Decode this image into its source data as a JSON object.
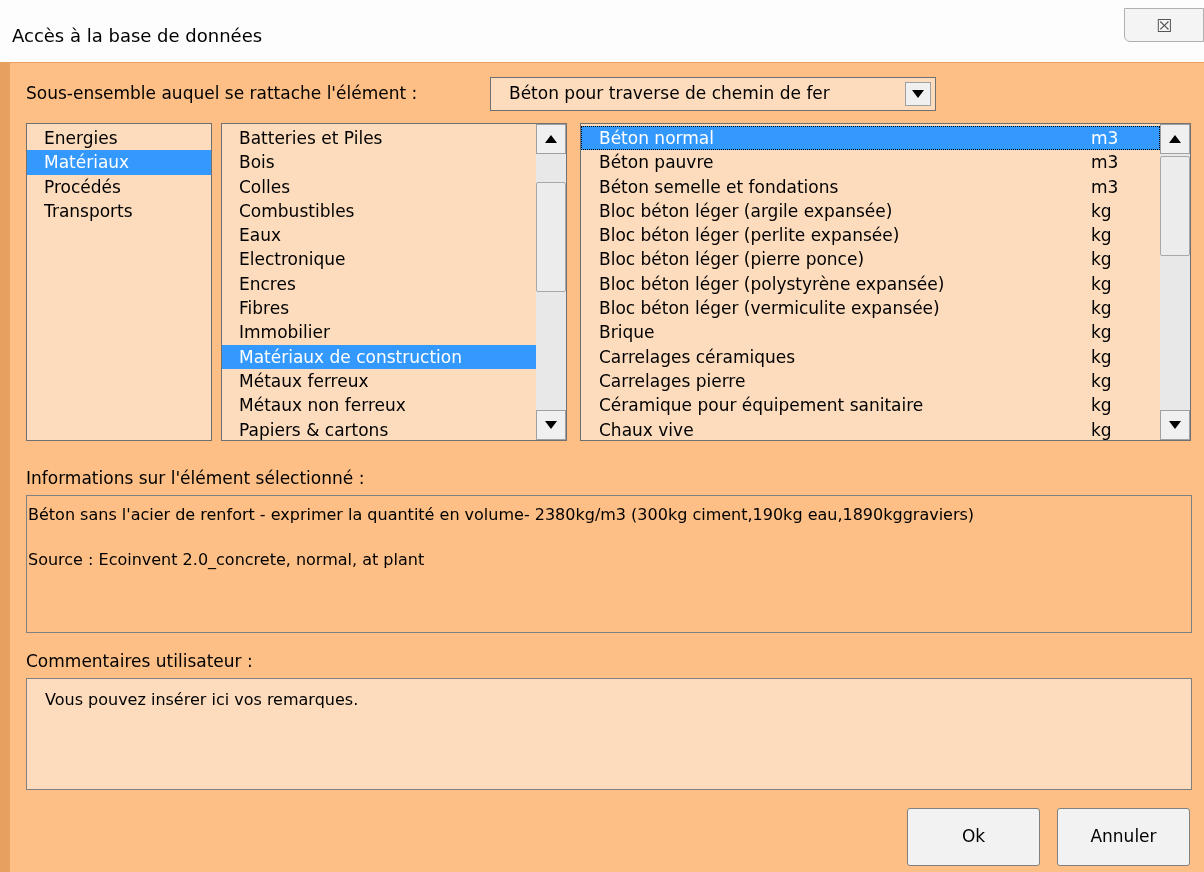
{
  "window": {
    "title": "Accès à la base de données",
    "close": "☒"
  },
  "subset": {
    "label": "Sous-ensemble auquel se rattache l'élément :",
    "value": "Béton pour traverse de chemin de fer"
  },
  "categories": [
    {
      "label": "Energies",
      "selected": false
    },
    {
      "label": "Matériaux",
      "selected": true
    },
    {
      "label": "Procédés",
      "selected": false
    },
    {
      "label": "Transports",
      "selected": false
    }
  ],
  "subcategories": [
    {
      "label": "Batteries et Piles",
      "selected": false
    },
    {
      "label": "Bois",
      "selected": false
    },
    {
      "label": "Colles",
      "selected": false
    },
    {
      "label": "Combustibles",
      "selected": false
    },
    {
      "label": "Eaux",
      "selected": false
    },
    {
      "label": "Electronique",
      "selected": false
    },
    {
      "label": "Encres",
      "selected": false
    },
    {
      "label": "Fibres",
      "selected": false
    },
    {
      "label": "Immobilier",
      "selected": false
    },
    {
      "label": "Matériaux de construction",
      "selected": true
    },
    {
      "label": "Métaux ferreux",
      "selected": false
    },
    {
      "label": "Métaux non ferreux",
      "selected": false
    },
    {
      "label": "Papiers & cartons",
      "selected": false
    }
  ],
  "elements": [
    {
      "name": "Béton normal",
      "unit": "m3",
      "selected": true
    },
    {
      "name": "Béton pauvre",
      "unit": "m3",
      "selected": false
    },
    {
      "name": "Béton semelle et fondations",
      "unit": "m3",
      "selected": false
    },
    {
      "name": "Bloc béton léger (argile expansée)",
      "unit": "kg",
      "selected": false
    },
    {
      "name": "Bloc béton léger (perlite expansée)",
      "unit": "kg",
      "selected": false
    },
    {
      "name": "Bloc béton léger (pierre ponce)",
      "unit": "kg",
      "selected": false
    },
    {
      "name": "Bloc béton léger (polystyrène expansée)",
      "unit": "kg",
      "selected": false
    },
    {
      "name": "Bloc béton léger (vermiculite expansée)",
      "unit": "kg",
      "selected": false
    },
    {
      "name": "Brique",
      "unit": "kg",
      "selected": false
    },
    {
      "name": "Carrelages céramiques",
      "unit": "kg",
      "selected": false
    },
    {
      "name": "Carrelages pierre",
      "unit": "kg",
      "selected": false
    },
    {
      "name": "Céramique pour équipement sanitaire",
      "unit": "kg",
      "selected": false
    },
    {
      "name": "Chaux vive",
      "unit": "kg",
      "selected": false
    }
  ],
  "info": {
    "label": "Informations sur l'élément sélectionné :",
    "lines": [
      "Béton sans l'acier de renfort - exprimer la quantité en volume- 2380kg/m3 (300kg ciment,190kg eau,1890kggraviers)",
      "Source : Ecoinvent 2.0_concrete, normal, at plant"
    ]
  },
  "comments": {
    "label": "Commentaires utilisateur :",
    "value": "Vous pouvez insérer ici vos remarques."
  },
  "buttons": [
    "Ok",
    "Annuler"
  ]
}
